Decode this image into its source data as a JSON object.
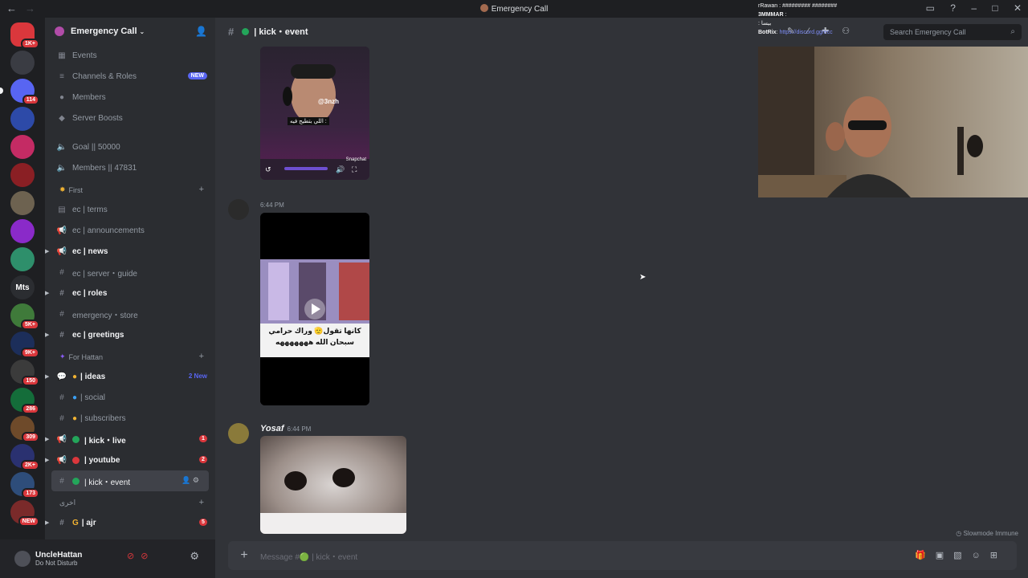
{
  "window": {
    "title": "Emergency Call"
  },
  "servers": [
    {
      "color": "#da373c",
      "badge": "1K+",
      "label": ""
    },
    {
      "color": "#3a3c43",
      "badge": "",
      "label": ""
    },
    {
      "color": "#5865f2",
      "badge": "114",
      "label": ""
    },
    {
      "color": "#2d4aa8",
      "badge": "",
      "label": ""
    },
    {
      "color": "#c42b64",
      "badge": "",
      "label": ""
    },
    {
      "color": "#8a1f24",
      "badge": "",
      "label": ""
    },
    {
      "color": "#6d6250",
      "badge": "",
      "label": ""
    },
    {
      "color": "#8a2ac9",
      "badge": "",
      "label": ""
    },
    {
      "color": "#2e8f6b",
      "badge": "",
      "label": ""
    },
    {
      "color": "#2b2d31",
      "badge": "",
      "label": "Mts"
    },
    {
      "color": "#3f7a3a",
      "badge": "5K+",
      "label": ""
    },
    {
      "color": "#1c2e5a",
      "badge": "9K+",
      "label": ""
    },
    {
      "color": "#3b3b3b",
      "badge": "150",
      "label": ""
    },
    {
      "color": "#146d3a",
      "badge": "286",
      "label": ""
    },
    {
      "color": "#6e4a2a",
      "badge": "309",
      "label": ""
    },
    {
      "color": "#2a3170",
      "badge": "2K+",
      "label": ""
    },
    {
      "color": "#2e4d7a",
      "badge": "173",
      "label": ""
    },
    {
      "color": "#7a2a2a",
      "badge": "NEW",
      "label": ""
    }
  ],
  "guild": {
    "name": "Emergency Call"
  },
  "sidebar": {
    "top_items": [
      {
        "label": "Events",
        "icon": "calendar-icon"
      },
      {
        "label": "Channels & Roles",
        "icon": "list-icon",
        "tag": "NEW"
      },
      {
        "label": "Members",
        "icon": "members-icon"
      },
      {
        "label": "Server Boosts",
        "icon": "boost-icon"
      }
    ],
    "voice_stats": [
      {
        "label": "Goal || 50000"
      },
      {
        "label": "Members || 47831"
      }
    ],
    "cat_first": "First",
    "first_channels": [
      {
        "label": "ec | terms",
        "icon": "#"
      },
      {
        "label": "ec | announcements",
        "icon": "📢"
      },
      {
        "label": "ec | news",
        "icon": "📢"
      },
      {
        "label": "ec | server・guide",
        "icon": "#"
      },
      {
        "label": "ec | roles",
        "icon": "#"
      },
      {
        "label": "emergency・store",
        "icon": "#"
      },
      {
        "label": "ec | greetings",
        "icon": "#"
      }
    ],
    "cat_hattan": "For Hattan",
    "hattan_channels": [
      {
        "label": "| ideas",
        "new": "2 New"
      },
      {
        "label": "| social"
      },
      {
        "label": "| subscribers"
      },
      {
        "label": "| kick・live",
        "badge": "1"
      },
      {
        "label": "| youtube",
        "badge": "2"
      },
      {
        "label": "| kick・event"
      }
    ],
    "cat_arabic": "اخرى",
    "last_channel": {
      "label": "| ajr",
      "badge": "5"
    }
  },
  "user": {
    "name": "UncleHattan",
    "status": "Do Not Disturb"
  },
  "channel": {
    "name": "| kick・event"
  },
  "messages": [
    {
      "time": "6:44 PM",
      "author": ""
    },
    {
      "time": "6:44 PM",
      "author": "Yosaf"
    }
  ],
  "media": {
    "video1_handle": "@3nzh",
    "video1_caption": "اللي بتطيح فيه :",
    "video1_brand": "Snapchat",
    "video2_caption_line1": "كانها تقول🫡 وراك حرامي",
    "video2_caption_line2": "سبحان الله هههههههه"
  },
  "composer": {
    "placeholder": "Message #🟢 | kick・event"
  },
  "search": {
    "placeholder": "Search Emergency Call"
  },
  "slowmode": "Slowmode Immune",
  "stream_chat": [
    {
      "user": "rRawan",
      "text": "#########  ########"
    },
    {
      "user": "3MMMAR",
      "text": ""
    },
    {
      "user": "",
      "text": ": بيسا"
    },
    {
      "user": "BotRix",
      "text": "https://discord.gg/ecc"
    }
  ]
}
